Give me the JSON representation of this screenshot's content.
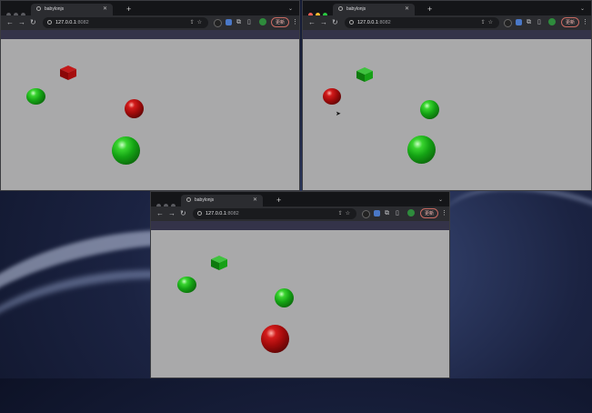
{
  "tab": {
    "title": "babylonjs"
  },
  "address": {
    "host": "127.0.0.1",
    "port": ":8082"
  },
  "toolbar": {
    "update_label": "更新"
  },
  "icons": {
    "back": "←",
    "forward": "→",
    "reload": "↻",
    "new_tab": "+",
    "close": "✕",
    "tab_menu": "⌄",
    "menu": "⋮",
    "share": "⇪",
    "star": "☆",
    "extensions": "⧉",
    "sidepanel": "▯"
  },
  "colors": {
    "viewport_bg": "#a9a9aa",
    "green_object": "#15a315",
    "red_object": "#a40b0b",
    "update_border": "#c96a62"
  },
  "scenes": [
    {
      "name": "top-left",
      "objects": [
        "red-cube",
        "green-sphere-small",
        "red-sphere",
        "green-sphere-large"
      ]
    },
    {
      "name": "top-right",
      "objects": [
        "green-cube",
        "red-sphere",
        "green-sphere-small",
        "green-sphere-large"
      ]
    },
    {
      "name": "bottom",
      "objects": [
        "green-cube",
        "green-sphere-small",
        "green-sphere-mid",
        "red-sphere-large"
      ]
    }
  ]
}
